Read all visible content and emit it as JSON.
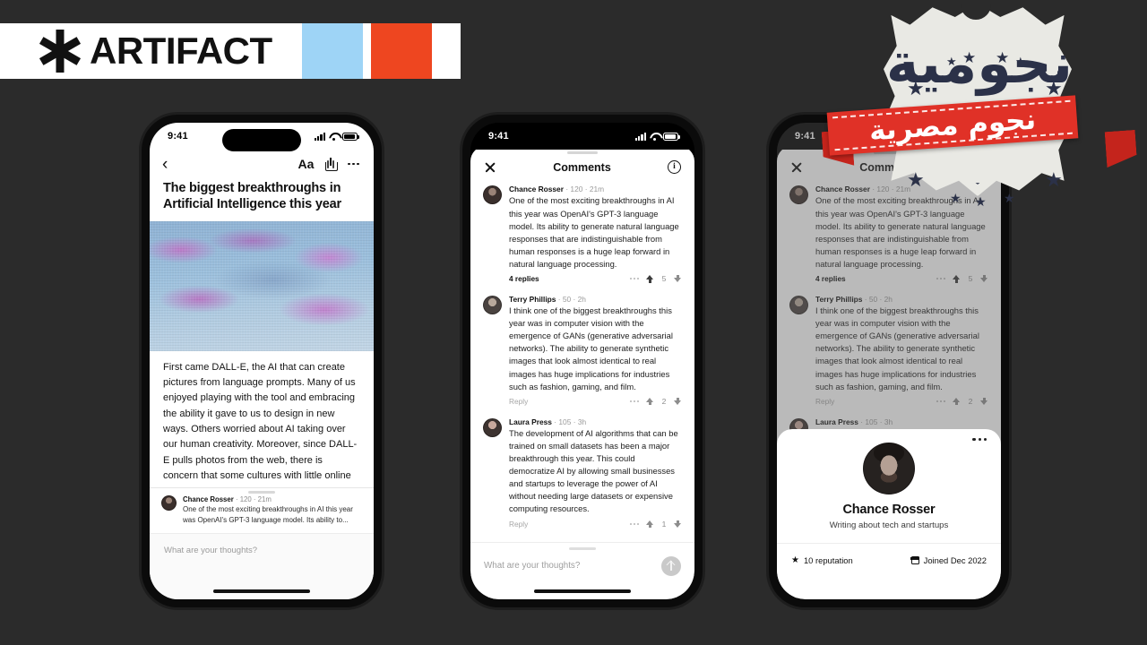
{
  "brand": {
    "name": "ARTIFACT",
    "logo_icon": "asterisk-icon",
    "swatch_blue": "#9ed4f6",
    "swatch_orange": "#ee4620",
    "background": "#2b2b2b"
  },
  "status_bar": {
    "time": "9:41",
    "signal_icon": "cellular-signal-icon",
    "wifi_icon": "wifi-icon",
    "battery_icon": "battery-icon"
  },
  "phone_article": {
    "toolbar": {
      "back_icon": "chevron-left-icon",
      "text_size_label": "Aa",
      "share_icon": "share-icon",
      "more_icon": "more-dots-icon"
    },
    "title": "The biggest breakthroughs in Artificial Intelligence this year",
    "hero_alt": "abstract-blue-purple-landscape",
    "body": "First came DALL-E, the AI that can create pictures from language prompts. Many of us enjoyed playing with the tool and embracing the ability it gave to us to design in new ways. Others worried about AI taking over our human creativity. Moreover, since DALL-E pulls photos from the web, there is concern that some cultures with little online representation will be left out of these",
    "preview_comment": {
      "author": "Chance Rosser",
      "meta": "· 120 · 21m",
      "text": "One of the most exciting breakthroughs in AI this year was OpenAI's GPT-3 language model. Its ability to..."
    },
    "compose_placeholder": "What are your thoughts?"
  },
  "phone_comments": {
    "header": {
      "close_icon": "close-x-icon",
      "title": "Comments",
      "info_icon": "info-circle-icon"
    },
    "comments": [
      {
        "author": "Chance Rosser",
        "meta": "· 120 · 21m",
        "text": "One of the most exciting breakthroughs in AI this year was OpenAI's GPT-3 language model. Its ability to generate natural language responses that are indistinguishable from human responses is a huge leap forward in natural language processing.",
        "action": "4 replies",
        "action_muted": false,
        "votes": "5",
        "upvoted": true,
        "more_icon": "more-dots-icon",
        "upvote_icon": "arrow-up-icon",
        "downvote_icon": "arrow-down-icon"
      },
      {
        "author": "Terry Phillips",
        "meta": "· 50 · 2h",
        "text": "I think one of the biggest breakthroughs this year was in computer vision with the emergence of GANs (generative adversarial networks). The ability to generate synthetic images that look almost identical to real images has huge implications for industries such as fashion, gaming, and film.",
        "action": "Reply",
        "action_muted": true,
        "votes": "2",
        "upvoted": false,
        "more_icon": "more-dots-icon",
        "upvote_icon": "arrow-up-icon",
        "downvote_icon": "arrow-down-icon"
      },
      {
        "author": "Laura Press",
        "meta": "· 105 · 3h",
        "text": "The development of AI algorithms that can be trained on small datasets has been a major breakthrough this year. This could democratize AI by allowing small businesses and startups to leverage the power of AI without needing large datasets or expensive computing resources.",
        "action": "Reply",
        "action_muted": true,
        "votes": "1",
        "upvoted": false,
        "more_icon": "more-dots-icon",
        "upvote_icon": "arrow-up-icon",
        "downvote_icon": "arrow-down-icon"
      }
    ],
    "compose_placeholder": "What are your thoughts?",
    "send_icon": "send-arrow-up-icon"
  },
  "phone_profile": {
    "more_icon": "more-dots-icon",
    "avatar_alt": "chance-rosser-avatar",
    "name": "Chance Rosser",
    "bio": "Writing about tech and startups",
    "stat_reputation": "10 reputation",
    "stat_reputation_icon": "star-icon",
    "stat_joined": "Joined Dec 2022",
    "stat_joined_icon": "calendar-icon"
  },
  "watermark": {
    "shield_text": "نجومية",
    "ribbon_text": "نجوم مصرية",
    "ribbon_color": "#e03127",
    "shield_color": "#e9e9e4"
  }
}
